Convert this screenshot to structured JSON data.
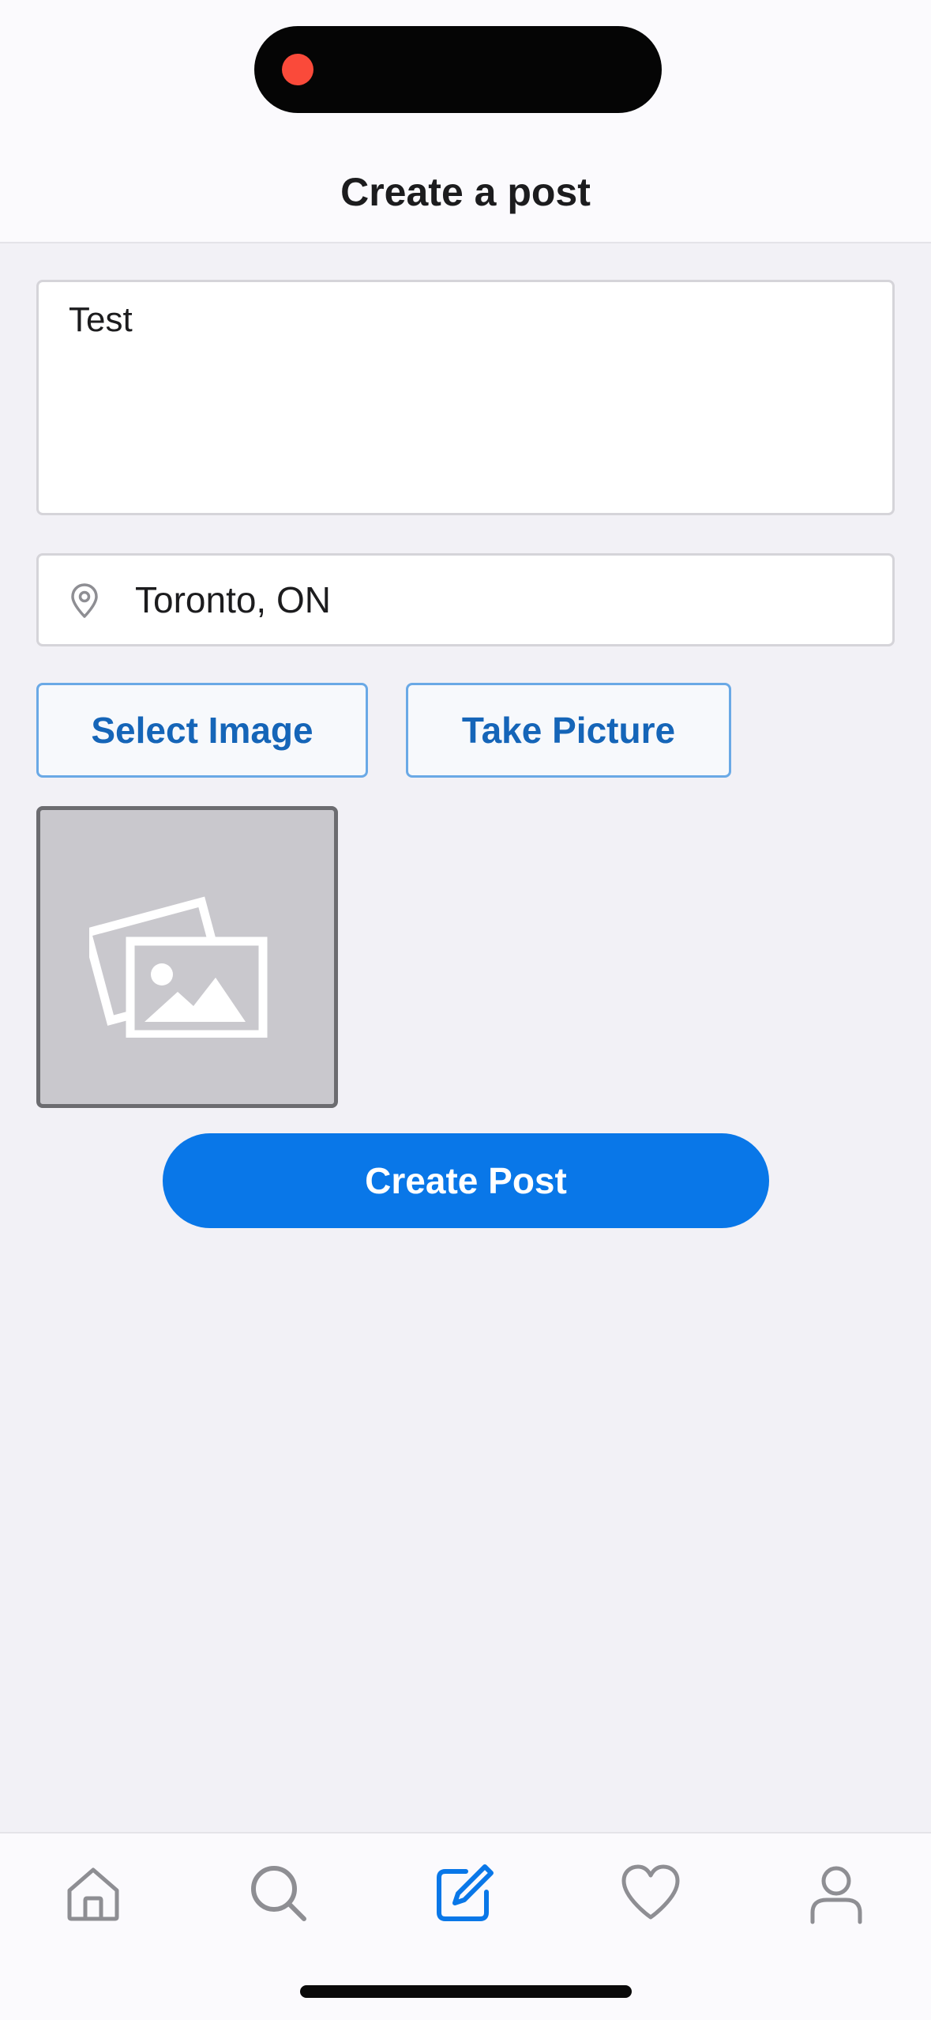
{
  "header": {
    "title": "Create a post"
  },
  "post": {
    "text_value": "Test",
    "location_value": "Toronto, ON"
  },
  "actions": {
    "select_image_label": "Select Image",
    "take_picture_label": "Take Picture",
    "create_post_label": "Create Post"
  },
  "image_preview": {
    "icon": "image-placeholder-icon"
  },
  "tab_bar": {
    "items": [
      {
        "icon": "home-icon",
        "active": false
      },
      {
        "icon": "search-icon",
        "active": false
      },
      {
        "icon": "compose-icon",
        "active": true
      },
      {
        "icon": "heart-icon",
        "active": false
      },
      {
        "icon": "profile-icon",
        "active": false
      }
    ]
  },
  "colors": {
    "accent": "#0977e8",
    "outline_button_text": "#1565b8",
    "background": "#f2f1f6",
    "inactive_icon": "#8e8e93",
    "recording_dot": "#fa4a3a"
  }
}
